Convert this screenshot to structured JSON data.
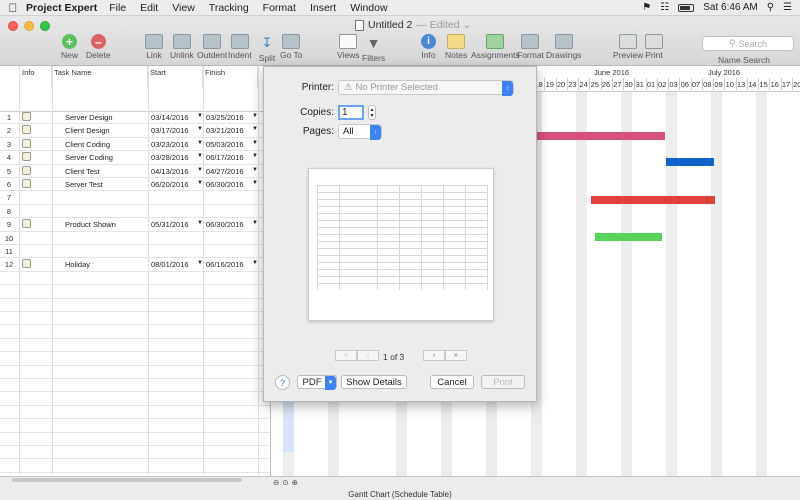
{
  "menubar": {
    "app_name": "Project Expert",
    "items": [
      "File",
      "Edit",
      "View",
      "Tracking",
      "Format",
      "Insert",
      "Window"
    ],
    "clock": "Sat 6:46 AM",
    "icons": [
      "apple-icon",
      "flag-icon",
      "wifi-icon",
      "battery-icon",
      "search-icon",
      "list-icon"
    ]
  },
  "window": {
    "title": "Untitled 2",
    "edited": "— Edited ⌄"
  },
  "toolbar": {
    "new": "New",
    "delete": "Delete",
    "link": "Link",
    "unlink": "Unlink",
    "outdent": "Outdent",
    "indent": "Indent",
    "split": "Split",
    "goto": "Go To",
    "views": "Views",
    "filters": "Filters",
    "info": "Info",
    "notes": "Notes",
    "assignments": "Assignments",
    "format": "Format",
    "drawings": "Drawings",
    "preview": "Preview",
    "print": "Print",
    "search_placeholder": "Search",
    "search_label": "Name Search"
  },
  "table": {
    "headers": {
      "info": "Info",
      "task_name": "Task Name",
      "start": "Start",
      "finish": "Finish"
    },
    "rows": [
      {
        "num": "1",
        "icon": true,
        "name": "Server Design",
        "start": "03/14/2016",
        "finish": "03/25/2016"
      },
      {
        "num": "2",
        "icon": true,
        "name": "Client Design",
        "start": "03/17/2016",
        "finish": "03/21/2016"
      },
      {
        "num": "3",
        "icon": true,
        "name": "Client Coding",
        "start": "03/23/2016",
        "finish": "05/03/2016"
      },
      {
        "num": "4",
        "icon": true,
        "name": "Server Coding",
        "start": "03/28/2016",
        "finish": "06/17/2016"
      },
      {
        "num": "5",
        "icon": true,
        "name": "Client Test",
        "start": "04/13/2016",
        "finish": "04/27/2016"
      },
      {
        "num": "6",
        "icon": true,
        "name": "Server Test",
        "start": "06/20/2016",
        "finish": "06/30/2016"
      },
      {
        "num": "7",
        "icon": false,
        "name": "",
        "start": "",
        "finish": ""
      },
      {
        "num": "8",
        "icon": false,
        "name": "",
        "start": "",
        "finish": ""
      },
      {
        "num": "9",
        "icon": true,
        "name": "Product Shown",
        "start": "05/31/2016",
        "finish": "06/30/2016"
      },
      {
        "num": "10",
        "icon": false,
        "name": "",
        "start": "",
        "finish": ""
      },
      {
        "num": "11",
        "icon": false,
        "name": "",
        "start": "",
        "finish": ""
      },
      {
        "num": "12",
        "icon": true,
        "name": "Holiday",
        "start": "08/01/2016",
        "finish": "06/16/2016"
      }
    ]
  },
  "gantt": {
    "months": [
      "June 2016",
      "July 2016"
    ],
    "days": [
      "16",
      "19",
      "22",
      "23",
      "24",
      "25",
      "26",
      "27",
      "30",
      "31",
      "01",
      "02",
      "03",
      "04",
      "05",
      "06",
      "07",
      "08",
      "09",
      "10",
      "11",
      "12",
      "13",
      "14",
      "15",
      "16",
      "17",
      "18",
      "19",
      "20"
    ],
    "days_top_row": [
      "18",
      "19",
      "20",
      "23",
      "24",
      "25",
      "26",
      "27",
      "30",
      "31",
      "01",
      "02",
      "03",
      "06",
      "07",
      "08",
      "09",
      "10",
      "13",
      "14",
      "15",
      "16",
      "17",
      "20",
      "21",
      "22",
      "23",
      "24",
      "27",
      "28",
      "29",
      "30",
      "01",
      "04",
      "05",
      "06",
      "07",
      "08",
      "11",
      "12",
      "13",
      "14",
      "15",
      "18",
      "19",
      "20"
    ],
    "bar_colors": {
      "pink": "#d9517b",
      "blue": "#0f63c9",
      "red": "#e0403a",
      "green": "#57d25a"
    }
  },
  "print_dialog": {
    "printer_label": "Printer:",
    "printer_value": "No Printer Selected",
    "copies_label": "Copies:",
    "copies_value": "1",
    "pages_label": "Pages:",
    "pages_value": "All",
    "page_of": "1 of 3",
    "help": "?",
    "pdf": "PDF",
    "show_details": "Show Details",
    "cancel": "Cancel",
    "print": "Print",
    "pager_first": "«",
    "pager_prev": "‹",
    "pager_next": "›",
    "pager_last": "»"
  },
  "status": {
    "view_name": "Gantt Chart (Schedule Table)"
  }
}
